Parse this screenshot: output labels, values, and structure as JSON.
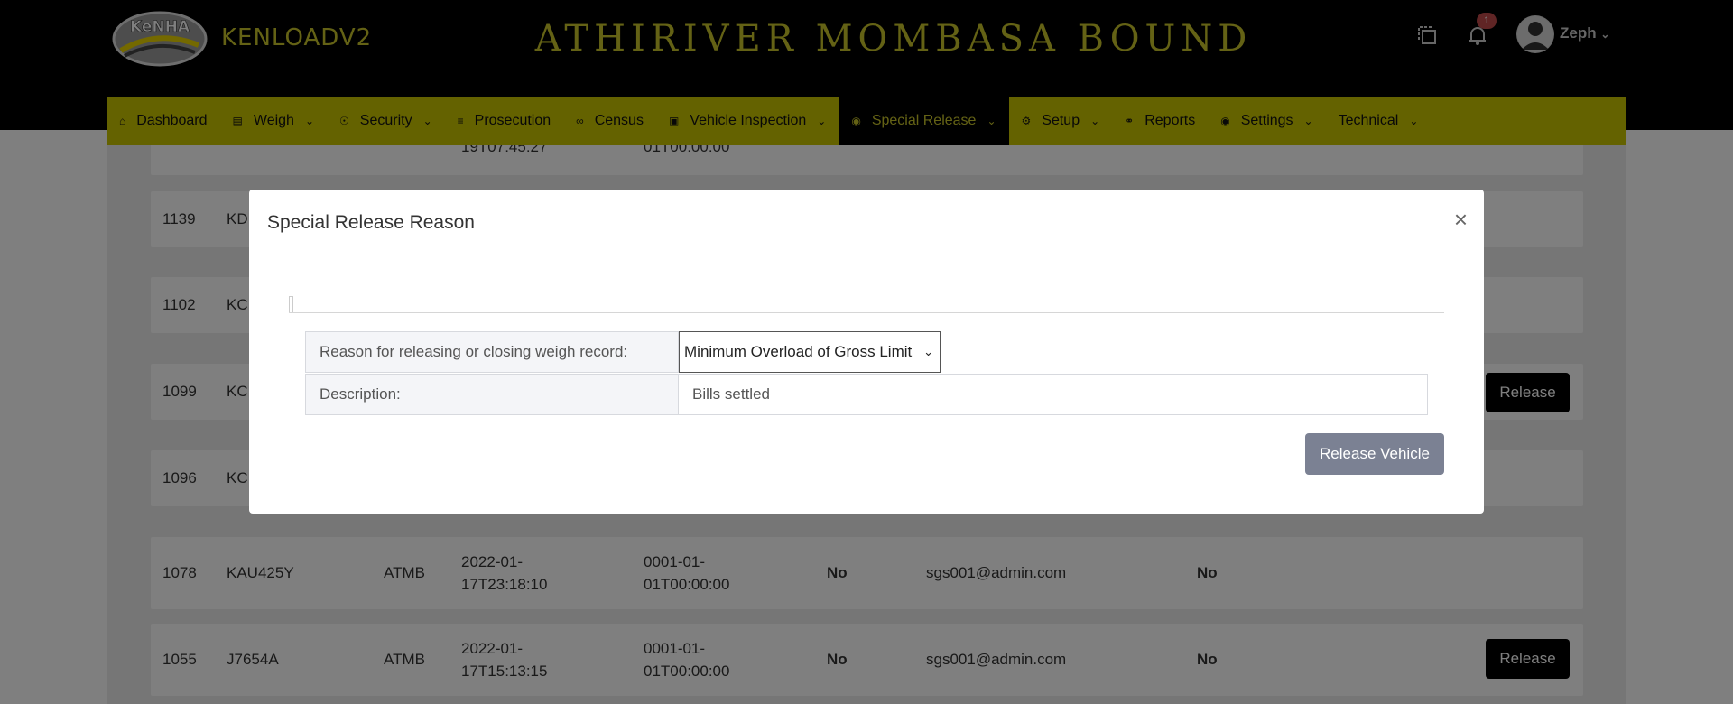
{
  "header": {
    "logo_text": "KeNHA",
    "brand": "KENLOADV2",
    "station": "ATHIRIVER MOMBASA BOUND",
    "notification_count": "1",
    "username": "Zeph"
  },
  "nav": {
    "items": [
      {
        "label": "Dashboard",
        "icon": "home-icon",
        "chevron": false
      },
      {
        "label": "Weigh",
        "icon": "scale-icon",
        "chevron": true
      },
      {
        "label": "Security",
        "icon": "lock-icon",
        "chevron": true
      },
      {
        "label": "Prosecution",
        "icon": "list-icon",
        "chevron": false
      },
      {
        "label": "Census",
        "icon": "census-icon",
        "chevron": false
      },
      {
        "label": "Vehicle Inspection",
        "icon": "truck-icon",
        "chevron": true
      },
      {
        "label": "Special Release",
        "icon": "target-icon",
        "chevron": true,
        "active": true
      },
      {
        "label": "Setup",
        "icon": "setup-icon",
        "chevron": true
      },
      {
        "label": "Reports",
        "icon": "paperclip-icon",
        "chevron": false
      },
      {
        "label": "Settings",
        "icon": "gear-icon",
        "chevron": true
      },
      {
        "label": "Technical",
        "icon": "",
        "chevron": true
      }
    ]
  },
  "table": {
    "rows": [
      {
        "id": "",
        "plate": "",
        "station": "",
        "date": "19T07:45:27",
        "date2": "01T00:00:00",
        "flag1": "",
        "user": "",
        "flag2": "",
        "release": ""
      },
      {
        "id": "1139",
        "plate": "KD",
        "station": "",
        "date": "",
        "date2": "",
        "flag1": "",
        "user": "",
        "flag2": "",
        "release": ""
      },
      {
        "id": "1102",
        "plate": "KC",
        "station": "",
        "date": "",
        "date2": "",
        "flag1": "",
        "user": "",
        "flag2": "",
        "release": ""
      },
      {
        "id": "1099",
        "plate": "KC",
        "station": "",
        "date": "",
        "date2": "",
        "flag1": "",
        "user": "",
        "flag2": "",
        "release": "Release"
      },
      {
        "id": "1096",
        "plate": "KC",
        "station": "",
        "date": "",
        "date2": "",
        "flag1": "",
        "user": "",
        "flag2": "",
        "release": ""
      },
      {
        "id": "1078",
        "plate": "KAU425Y",
        "station": "ATMB",
        "date": "2022-01-\n17T23:18:10",
        "date2": "0001-01-\n01T00:00:00",
        "flag1": "No",
        "user": "sgs001@admin.com",
        "flag2": "No",
        "release": ""
      },
      {
        "id": "1055",
        "plate": "J7654A",
        "station": "ATMB",
        "date": "2022-01-\n17T15:13:15",
        "date2": "0001-01-\n01T00:00:00",
        "flag1": "No",
        "user": "sgs001@admin.com",
        "flag2": "No",
        "release": "Release"
      }
    ]
  },
  "modal": {
    "title": "Special Release Reason",
    "close": "×",
    "reason_label": "Reason for releasing or closing weigh record:",
    "reason_value": "Minimum Overload of Gross Limit",
    "description_label": "Description:",
    "description_value": "Bills settled",
    "submit_label": "Release Vehicle"
  }
}
